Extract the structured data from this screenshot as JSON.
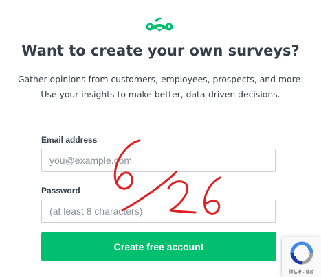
{
  "brand": {
    "logo_icon": "surveymonkey-logo-icon",
    "accent_color": "#00bf6f"
  },
  "hero": {
    "headline": "Want to create your own surveys?",
    "subline_1": "Gather opinions from customers, employees, prospects, and more.",
    "subline_2": "Use your insights to make better, data-driven decisions."
  },
  "form": {
    "email_label": "Email address",
    "email_placeholder": "you@example.com",
    "email_value": "",
    "password_label": "Password",
    "password_placeholder": "(at least 8 characters)",
    "password_value": "",
    "submit_label": "Create free account"
  },
  "annotation": {
    "handwritten_text": "6/26",
    "ink_color": "#e02020"
  },
  "recaptcha": {
    "icon": "recaptcha-icon",
    "privacy_link": "隱私權",
    "terms_link": "條款",
    "separator": " - "
  }
}
